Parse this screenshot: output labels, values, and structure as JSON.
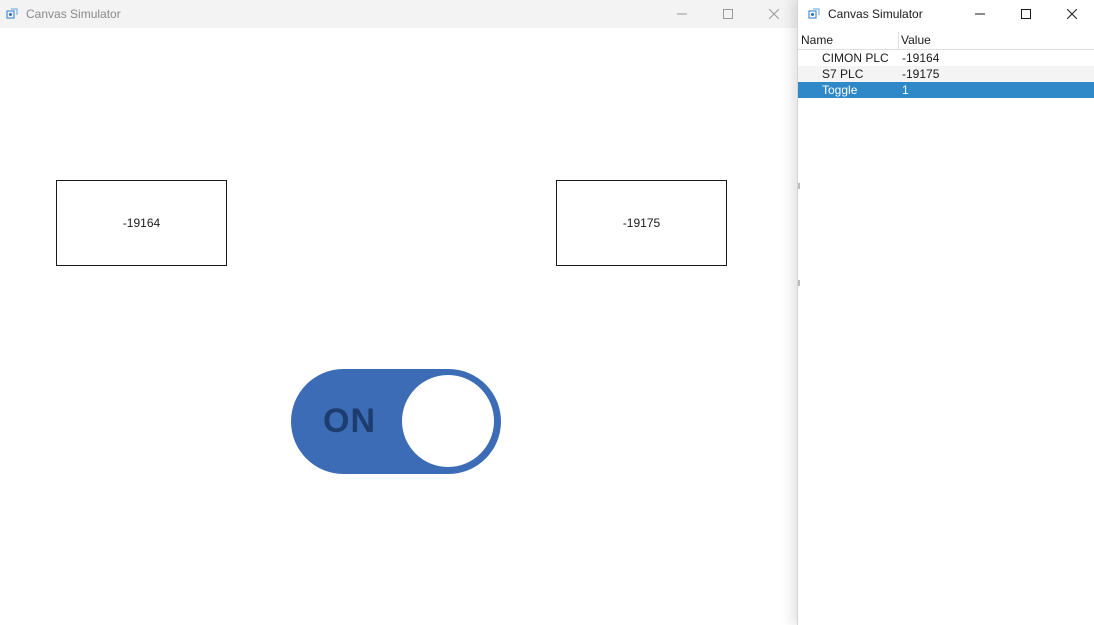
{
  "main_window": {
    "title": "Canvas Simulator",
    "icon": "canvas-app-icon",
    "controls": [
      "minimize-icon",
      "maximize-icon",
      "close-icon"
    ],
    "boxes": [
      {
        "value": "-19164"
      },
      {
        "value": "-19175"
      }
    ],
    "toggle": {
      "label": "ON",
      "state": "on",
      "color": "#3b6cb5"
    }
  },
  "side_window": {
    "title": "Canvas Simulator",
    "icon": "canvas-app-icon",
    "controls": [
      "minimize-icon",
      "maximize-icon",
      "close-icon"
    ],
    "list": {
      "columns": [
        "Name",
        "Value"
      ],
      "rows": [
        {
          "name": "CIMON PLC",
          "value": "-19164"
        },
        {
          "name": "S7 PLC",
          "value": "-19175"
        },
        {
          "name": "Toggle",
          "value": "1",
          "selected": true
        }
      ],
      "selection_color": "#2f88c8"
    }
  }
}
